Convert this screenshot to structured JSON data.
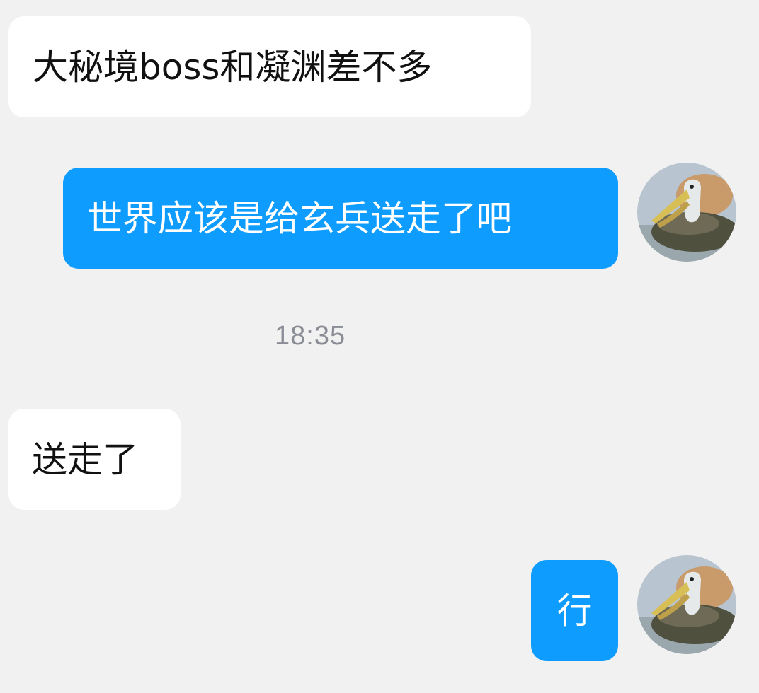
{
  "messages": [
    {
      "direction": "incoming",
      "text": "大秘境boss和凝渊差不多"
    },
    {
      "direction": "outgoing",
      "text": "世界应该是给玄兵送走了吧"
    },
    {
      "direction": "incoming",
      "text": "送走了"
    },
    {
      "direction": "outgoing",
      "text": "行"
    }
  ],
  "timestamp": "18:35",
  "avatar": {
    "icon": "pelican-avatar-icon"
  },
  "colors": {
    "background": "#f1f1f1",
    "incoming_bubble": "#ffffff",
    "outgoing_bubble": "#0e9cff",
    "incoming_text": "#111111",
    "outgoing_text": "#ffffff",
    "timestamp_text": "#8a8d96"
  }
}
